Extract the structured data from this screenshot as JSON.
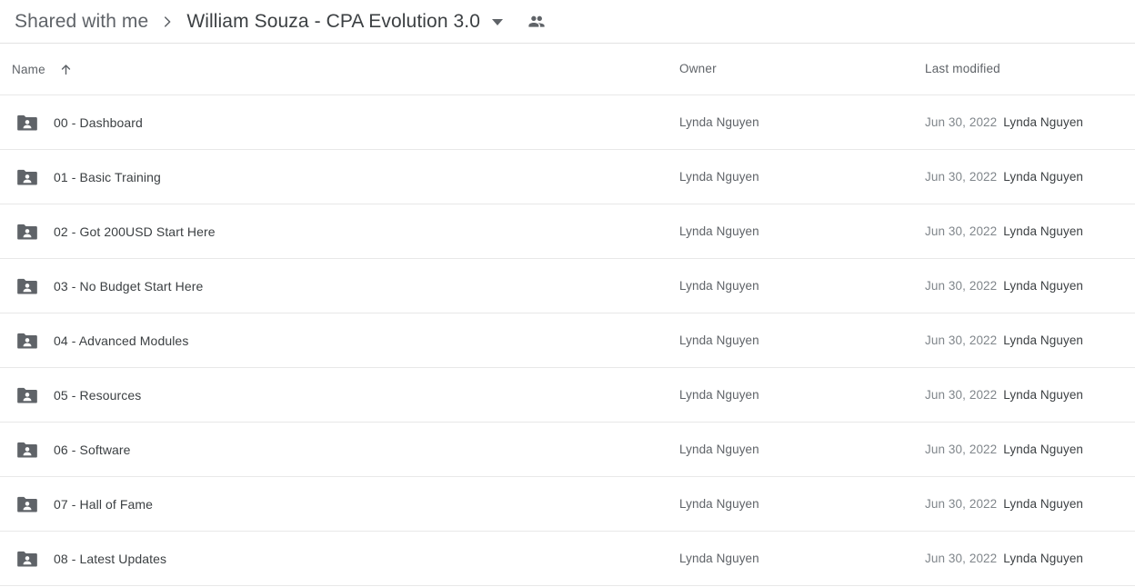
{
  "breadcrumb": {
    "parent_label": "Shared with me",
    "separator_icon": "chevron-right-icon",
    "current_label": "William Souza - CPA Evolution 3.0",
    "dropdown_icon": "chevron-down-icon",
    "people_icon": "people-shared-icon"
  },
  "table": {
    "headers": {
      "name": "Name",
      "sort_icon": "arrow-up-icon",
      "owner": "Owner",
      "last_modified": "Last modified"
    },
    "rows": [
      {
        "icon": "shared-folder-icon",
        "name": "00 - Dashboard",
        "owner": "Lynda Nguyen",
        "modified_date": "Jun 30, 2022",
        "modified_by": "Lynda Nguyen"
      },
      {
        "icon": "shared-folder-icon",
        "name": "01 - Basic Training",
        "owner": "Lynda Nguyen",
        "modified_date": "Jun 30, 2022",
        "modified_by": "Lynda Nguyen"
      },
      {
        "icon": "shared-folder-icon",
        "name": "02 - Got 200USD Start Here",
        "owner": "Lynda Nguyen",
        "modified_date": "Jun 30, 2022",
        "modified_by": "Lynda Nguyen"
      },
      {
        "icon": "shared-folder-icon",
        "name": "03 - No Budget Start Here",
        "owner": "Lynda Nguyen",
        "modified_date": "Jun 30, 2022",
        "modified_by": "Lynda Nguyen"
      },
      {
        "icon": "shared-folder-icon",
        "name": "04 - Advanced Modules",
        "owner": "Lynda Nguyen",
        "modified_date": "Jun 30, 2022",
        "modified_by": "Lynda Nguyen"
      },
      {
        "icon": "shared-folder-icon",
        "name": "05 - Resources",
        "owner": "Lynda Nguyen",
        "modified_date": "Jun 30, 2022",
        "modified_by": "Lynda Nguyen"
      },
      {
        "icon": "shared-folder-icon",
        "name": "06 - Software",
        "owner": "Lynda Nguyen",
        "modified_date": "Jun 30, 2022",
        "modified_by": "Lynda Nguyen"
      },
      {
        "icon": "shared-folder-icon",
        "name": "07 - Hall of Fame",
        "owner": "Lynda Nguyen",
        "modified_date": "Jun 30, 2022",
        "modified_by": "Lynda Nguyen"
      },
      {
        "icon": "shared-folder-icon",
        "name": "08 - Latest Updates",
        "owner": "Lynda Nguyen",
        "modified_date": "Jun 30, 2022",
        "modified_by": "Lynda Nguyen"
      }
    ]
  },
  "colors": {
    "folder_icon": "#5f6368",
    "text_primary": "#3c4043",
    "text_secondary": "#5f6368",
    "text_muted": "#80868b",
    "divider": "#e8e8e8",
    "background": "#ffffff"
  }
}
